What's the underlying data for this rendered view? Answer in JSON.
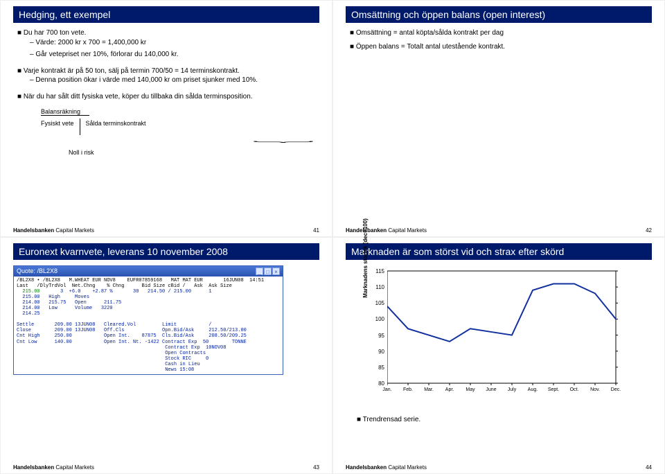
{
  "slides": {
    "s41": {
      "title": "Hedging, ett exempel",
      "b1": "Du har 700 ton vete.",
      "b1a": "Värde: 2000 kr x 700 = 1,400,000 kr",
      "b1b": "Går vetepriset ner 10%, förlorar du 140,000 kr.",
      "b2": "Varje kontrakt är på 50 ton, sälj på termin 700/50 = 14 terminskontrakt.",
      "b2a": "Denna position ökar i värde med 140,000 kr om priset sjunker med 10%.",
      "b3": "När du har sålt ditt fysiska vete, köper du tillbaka din sålda terminsposition.",
      "balans_title": "Balansräkning",
      "balans_left": "Fysiskt vete",
      "balans_right": "Sålda terminskontrakt",
      "noll": "Noll i risk",
      "page": "41"
    },
    "s42": {
      "title": "Omsättning och öppen balans (open interest)",
      "b1": "Omsättning = antal köpta/sålda kontrakt per dag",
      "b2": "Öppen balans = Totalt antal utestående kontrakt.",
      "page": "42"
    },
    "s43": {
      "title": "Euronext kvarnvete, leverans 10 november 2008",
      "page": "43",
      "quote": {
        "win_title": "Quote: /BL2X8",
        "hdr1": "/BL2X8 • /BL2X8   M.WHEAT EUR NOV8    EUFR07859168   MAT MAT EUR       16JUN08  14:51",
        "hdr2": "Last   /DlyTrdVol  Net.Chng    % Chng      Bid Size cBid /   Ask  Ask Size",
        "row1_a": "  215.00",
        "row1_b": "       3  +6.0    +2.87 %       30   214.50 / 215.00      1",
        "mid": "  215.00   High     Moves\n  214.00   215.75   Open      211.75\n  214.00   Low      Volume   3220\n  214.25\n",
        "lower": "Settle       209.00 13JUN08   Cleared.Vol         Limit           /\nClose        209.00 13JUN08   Off.Cls             Opn.Bid/Ask     212.50/213.00\nCnt High     250.00           Open Int.    87875  Cls.Bid/Ask     208.50/209.25\nCnt Low      140.00           Open Int. Nt. -1422 Contract Exp  50        TONNE\n                                                   Contract Exp  10NOV08\n                                                   Open Contracts\n                                                   Stock RIC     0\n                                                   Cash in Lieu\n                                                   News 15:08"
      }
    },
    "s44": {
      "title": "Marknaden är som störst vid och strax efter skörd",
      "page": "44",
      "note": "Trendrensad serie.",
      "ylabel": "Marknadens storlek (dec=100)"
    }
  },
  "footer_brand": "Handelsbanken",
  "footer_sub": " Capital Markets",
  "chart_data": {
    "type": "line",
    "categories": [
      "Jan.",
      "Feb.",
      "Mar.",
      "Apr.",
      "May",
      "June",
      "July",
      "Aug.",
      "Sept.",
      "Oct.",
      "Nov.",
      "Dec."
    ],
    "values": [
      104,
      97,
      95,
      93,
      97,
      96,
      95,
      109,
      111,
      111,
      108,
      100
    ],
    "ylabel": "Marknadens storlek (dec=100)",
    "ylim": [
      80,
      115
    ],
    "yticks": [
      80,
      85,
      90,
      95,
      100,
      105,
      110,
      115
    ]
  }
}
